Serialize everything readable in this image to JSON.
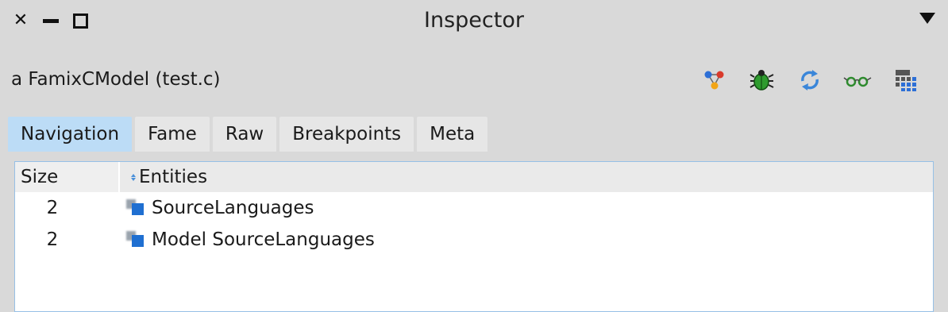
{
  "window": {
    "title": "Inspector"
  },
  "inspector": {
    "object_title": "a FamixCModel (test.c)"
  },
  "toolbar": {
    "icons": [
      "visualize-icon",
      "debug-bug-icon",
      "refresh-icon",
      "browse-glasses-icon",
      "calculator-grid-icon"
    ]
  },
  "tabs": [
    {
      "label": "Navigation",
      "active": true
    },
    {
      "label": "Fame",
      "active": false
    },
    {
      "label": "Raw",
      "active": false
    },
    {
      "label": "Breakpoints",
      "active": false
    },
    {
      "label": "Meta",
      "active": false
    }
  ],
  "table": {
    "columns": [
      "Size",
      "Entities"
    ],
    "rows": [
      {
        "size": "2",
        "entity": "SourceLanguages"
      },
      {
        "size": "2",
        "entity": "Model SourceLanguages"
      }
    ]
  },
  "colors": {
    "active_tab": "#bcdcf6",
    "tab": "#e6e6e6",
    "background": "#d9d9d9",
    "entity_icon": "#1f6fd1"
  }
}
